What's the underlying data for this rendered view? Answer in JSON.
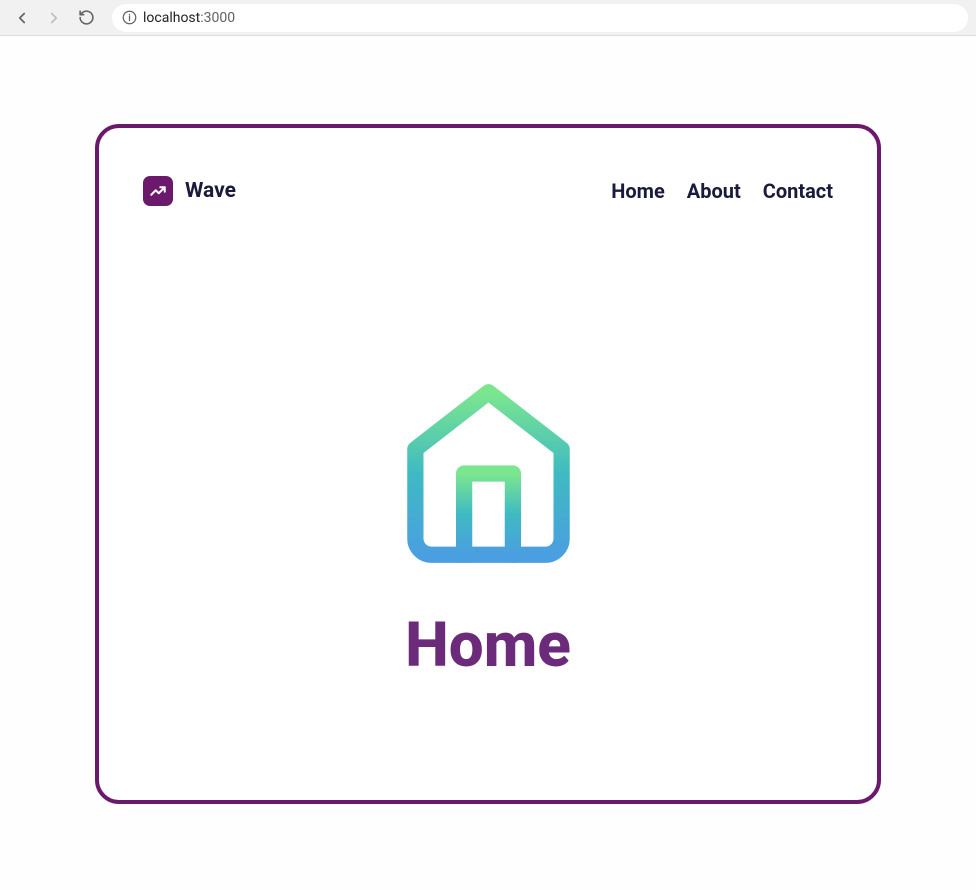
{
  "browser": {
    "url_host": "localhost",
    "url_port": ":3000"
  },
  "brand": {
    "name": "Wave"
  },
  "nav": {
    "items": [
      {
        "label": "Home"
      },
      {
        "label": "About"
      },
      {
        "label": "Contact"
      }
    ]
  },
  "content": {
    "title": "Home"
  },
  "colors": {
    "accent": "#6b1a6b",
    "text_dark": "#1a1a3d",
    "gradient_start": "#7ce68f",
    "gradient_mid": "#3fbac2",
    "gradient_end": "#4a9fe0"
  }
}
